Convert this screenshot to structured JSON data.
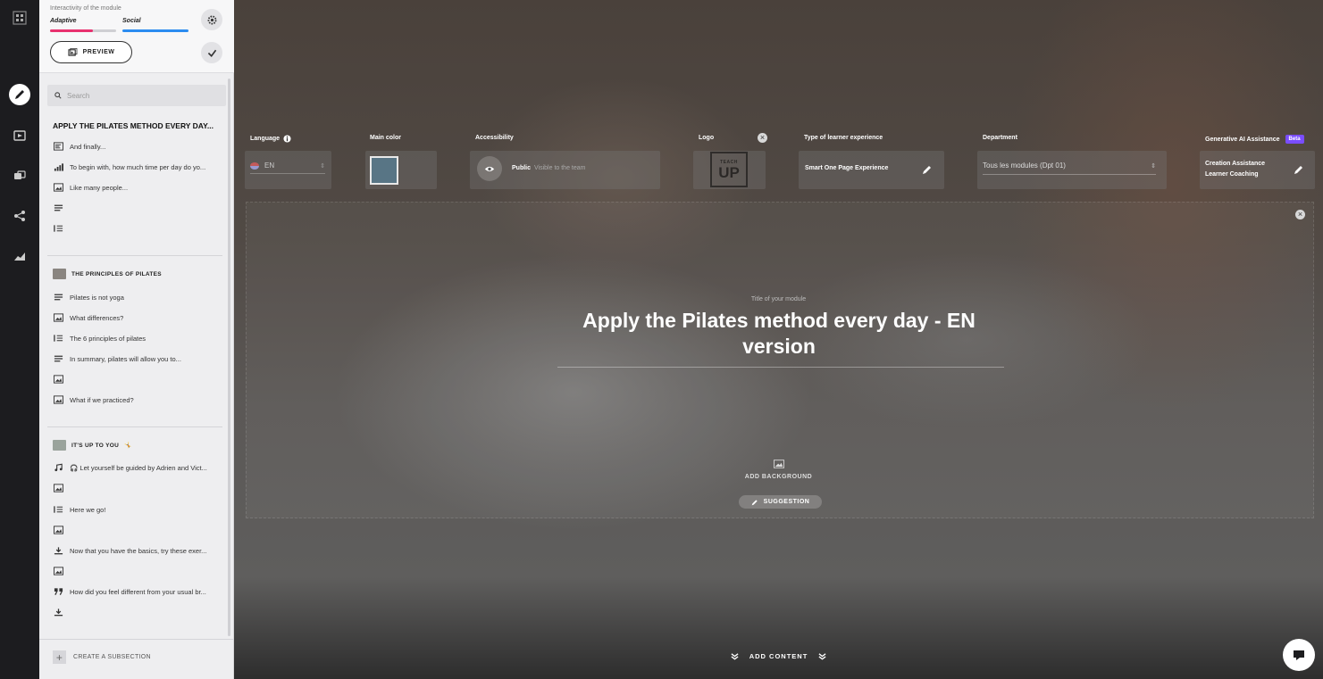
{
  "sidebar": {
    "interactivity_label": "Interactivity of the module",
    "tag_adaptive": "Adaptive",
    "tag_social": "Social",
    "preview_label": "PREVIEW",
    "search_placeholder": "Search",
    "module_title": "APPLY THE PILATES METHOD EVERY DAY...",
    "intro_items": [
      {
        "icon": "form-icon",
        "label": "And finally..."
      },
      {
        "icon": "poll-icon",
        "label": "To begin with, how much time per day do yo..."
      },
      {
        "icon": "image-icon",
        "label": "Like many people..."
      },
      {
        "icon": "text-icon",
        "label": ""
      },
      {
        "icon": "list-icon",
        "label": ""
      }
    ],
    "section1": {
      "title": "THE PRINCIPLES OF PILATES",
      "items": [
        {
          "icon": "text-icon",
          "label": "Pilates is not yoga"
        },
        {
          "icon": "image-icon",
          "label": "What differences?"
        },
        {
          "icon": "list-icon",
          "label": "The 6 principles of pilates"
        },
        {
          "icon": "text-icon",
          "label": "In summary, pilates will allow you to..."
        },
        {
          "icon": "image-icon",
          "label": ""
        },
        {
          "icon": "image-icon",
          "label": "What if we practiced?"
        }
      ]
    },
    "section2": {
      "title": "IT'S UP TO YOU",
      "title_emoji": "🤸",
      "items": [
        {
          "icon": "music-icon",
          "label": "🎧 Let yourself be guided by Adrien and Vict..."
        },
        {
          "icon": "image-icon",
          "label": ""
        },
        {
          "icon": "list-icon",
          "label": "Here we go!"
        },
        {
          "icon": "image-icon",
          "label": ""
        },
        {
          "icon": "download-icon",
          "label": "Now that you have the basics, try these exer..."
        },
        {
          "icon": "image-icon",
          "label": ""
        },
        {
          "icon": "quote-icon",
          "label": "How did you feel different from your usual br..."
        },
        {
          "icon": "download-icon",
          "label": ""
        }
      ]
    },
    "create_subsection_label": "CREATE A SUBSECTION"
  },
  "settings": {
    "language_label": "Language",
    "language_value": "EN",
    "main_color_label": "Main color",
    "main_color_value": "#587585",
    "accessibility_label": "Accessibility",
    "accessibility_value": "Public",
    "accessibility_sub": "Visible to the team",
    "logo_label": "Logo",
    "logo_text_top": "TEACH",
    "logo_text_main": "UP",
    "experience_label": "Type of learner experience",
    "experience_value": "Smart One Page Experience",
    "department_label": "Department",
    "department_value": "Tous les modules (Dpt 01)",
    "ai_label": "Generative AI Assistance",
    "ai_badge": "Beta",
    "ai_line1": "Creation Assistance",
    "ai_line2": "Learner Coaching"
  },
  "main": {
    "title_label": "Title of your module",
    "module_title": "Apply the Pilates method every day - EN version",
    "add_background": "ADD BACKGROUND",
    "suggestion": "SUGGESTION",
    "add_content": "ADD CONTENT"
  },
  "colors": {
    "adaptive_bar": "#e8316f",
    "social_bar": "#2b8cf0",
    "beta": "#7a4dff"
  }
}
